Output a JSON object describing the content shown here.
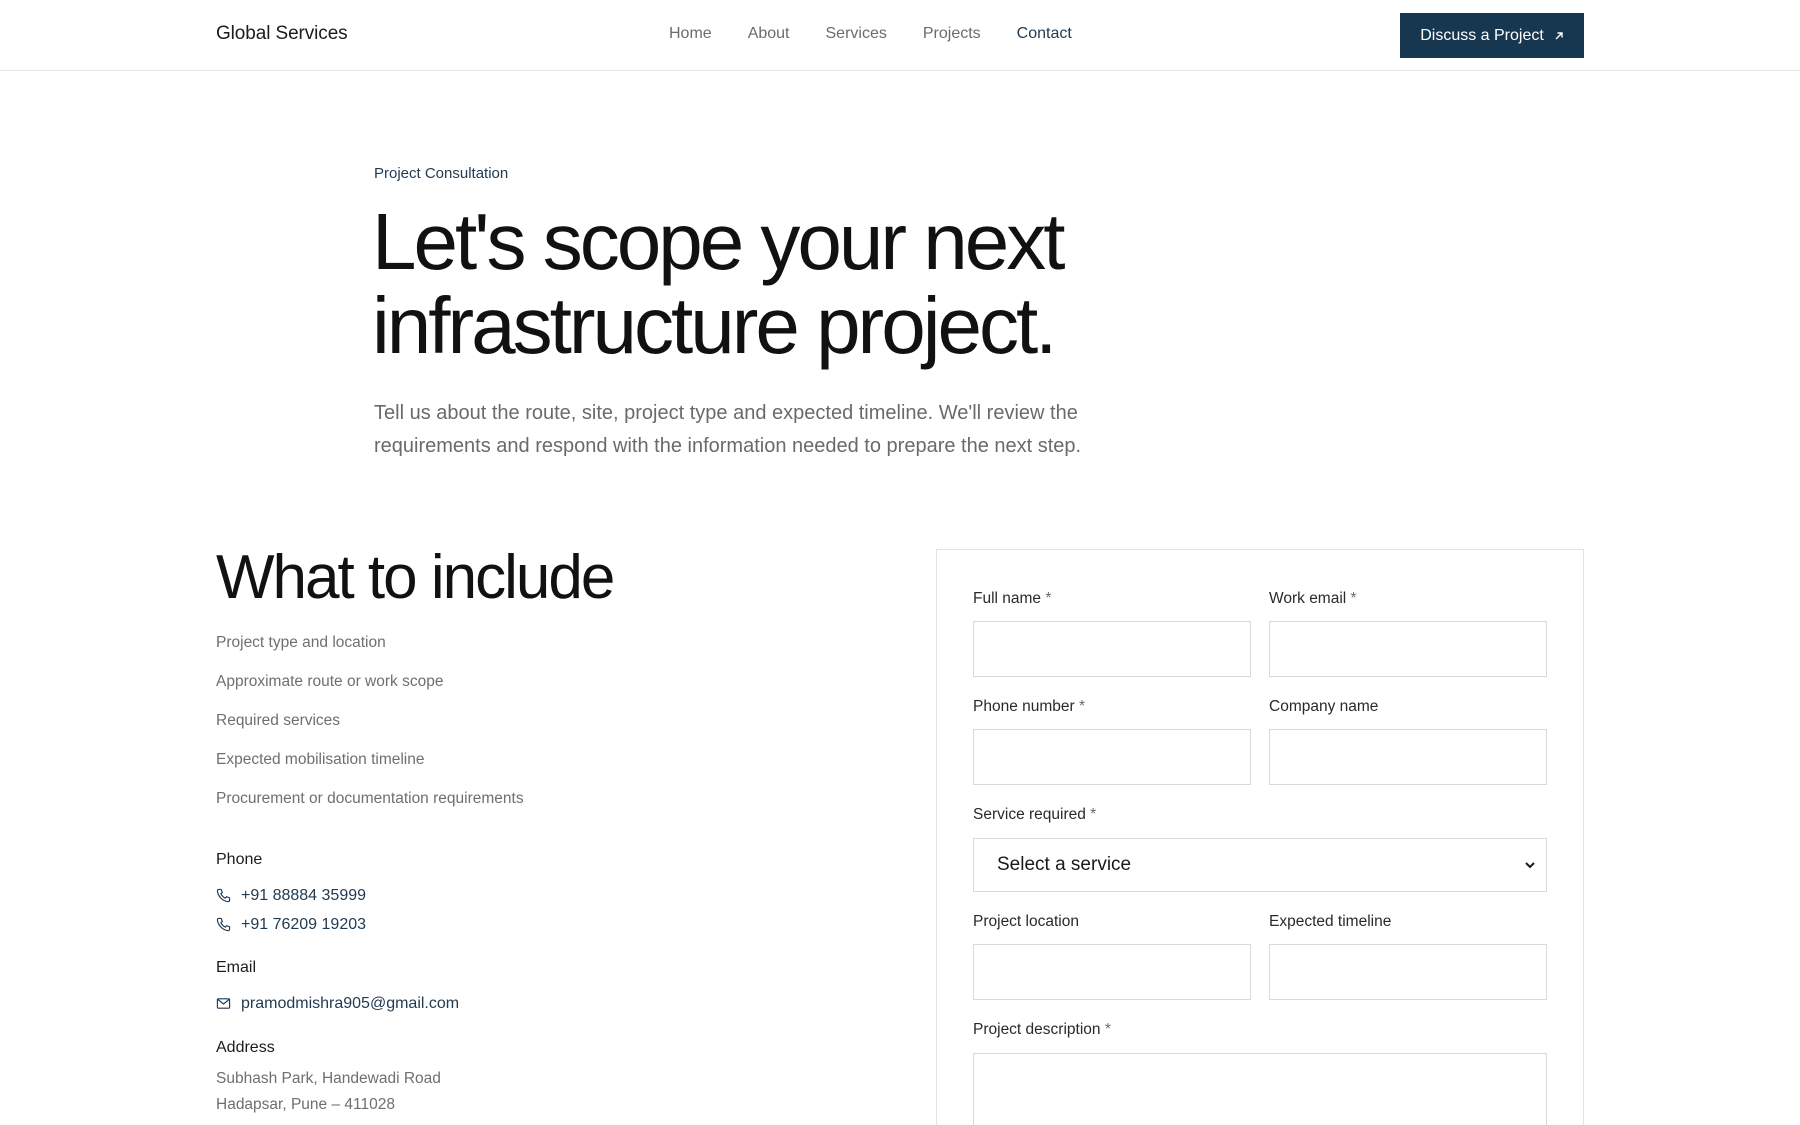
{
  "header": {
    "brand": "Global Services",
    "nav": [
      "Home",
      "About",
      "Services",
      "Projects",
      "Contact"
    ],
    "active_nav": "Contact",
    "cta_label": "Discuss a Project"
  },
  "hero": {
    "eyebrow": "Project Consultation",
    "title_line1": "Let's scope your next",
    "title_line2": "infrastructure project.",
    "subtitle": "Tell us about the route, site, project type and expected timeline. We'll review the requirements and respond with the information needed to prepare the next step."
  },
  "include": {
    "title": "What to include",
    "items": [
      "Project type and location",
      "Approximate route or work scope",
      "Required services",
      "Expected mobilisation timeline",
      "Procurement or documentation requirements"
    ]
  },
  "contact": {
    "phone_heading": "Phone",
    "phones": [
      "+91 88884 35999",
      "+91 76209 19203"
    ],
    "email_heading": "Email",
    "email": "pramodmishra905@gmail.com",
    "address_heading": "Address",
    "address_lines": [
      "Subhash Park, Handewadi Road",
      "Hadapsar, Pune – 411028"
    ]
  },
  "form": {
    "full_name_label": "Full name",
    "work_email_label": "Work email",
    "phone_label": "Phone number",
    "company_label": "Company name",
    "service_label": "Service required",
    "service_selected": "Select a service",
    "location_label": "Project location",
    "timeline_label": "Expected timeline",
    "description_label": "Project description",
    "required_mark": "*"
  },
  "colors": {
    "accent": "#173650",
    "link": "#1f3a52",
    "muted_text": "#6f6f6f",
    "border": "#d9d9d9"
  }
}
